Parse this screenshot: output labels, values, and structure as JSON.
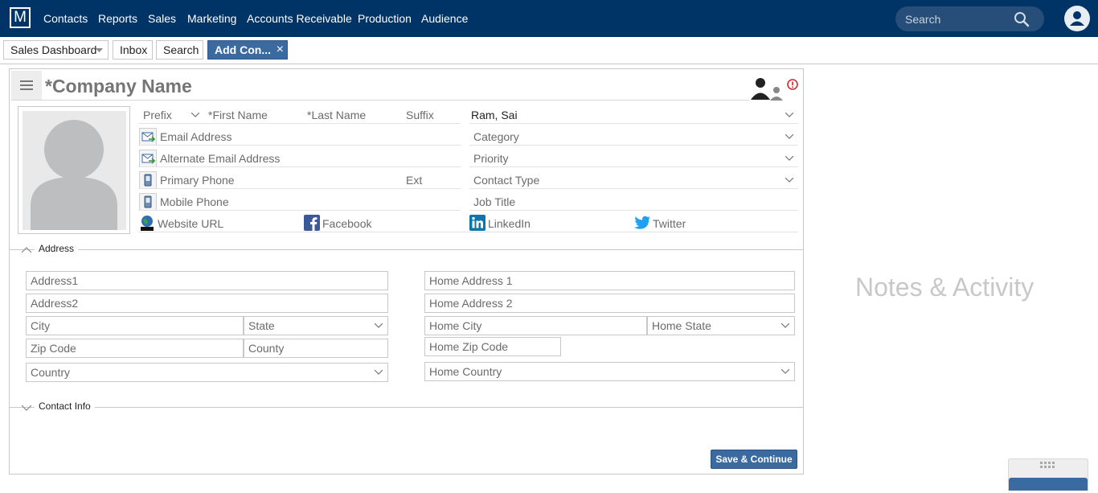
{
  "nav": {
    "logo": "M",
    "items": [
      "Contacts",
      "Reports",
      "Sales",
      "Marketing",
      "Accounts Receivable",
      "Production",
      "Audience"
    ],
    "search_placeholder": "Search"
  },
  "tabs": {
    "dashboard": "Sales Dashboard",
    "inbox": "Inbox",
    "search": "Search",
    "active": "Add Con...",
    "close": "×"
  },
  "form": {
    "company_placeholder": "*Company Name",
    "prefix": "Prefix",
    "first_name": "*First Name",
    "last_name": "*Last Name",
    "suffix": "Suffix",
    "owner": "Ram, Sai",
    "email": "Email Address",
    "alt_email": "Alternate Email Address",
    "category": "Category",
    "priority": "Priority",
    "primary_phone": "Primary Phone",
    "ext": "Ext",
    "contact_type": "Contact Type",
    "mobile_phone": "Mobile Phone",
    "job_title": "Job Title",
    "website": "Website URL",
    "facebook": "Facebook",
    "linkedin": "LinkedIn",
    "twitter": "Twitter"
  },
  "address": {
    "section_label": "Address",
    "address1": "Address1",
    "address2": "Address2",
    "city": "City",
    "state": "State",
    "zip": "Zip Code",
    "county": "County",
    "country": "Country",
    "home_address1": "Home Address 1",
    "home_address2": "Home Address 2",
    "home_city": "Home City",
    "home_state": "Home State",
    "home_zip": "Home Zip Code",
    "home_country": "Home Country"
  },
  "contact_info": {
    "section_label": "Contact Info"
  },
  "save_button": "Save & Continue",
  "notes_title": "Notes & Activity",
  "colors": {
    "nav_bg": "#003366",
    "accent": "#3a6aa0",
    "alert": "#cc2222"
  }
}
